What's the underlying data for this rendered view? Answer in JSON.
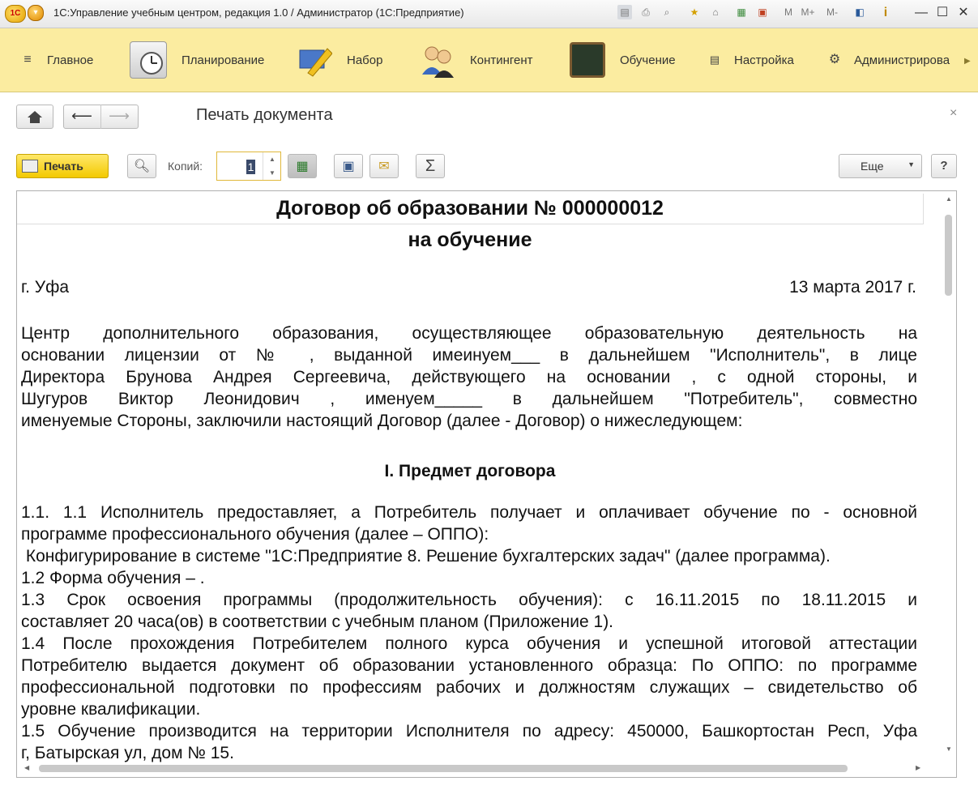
{
  "window": {
    "title": "1С:Управление учебным центром, редакция 1.0 / Администратор  (1С:Предприятие)",
    "logo_text": "1С",
    "controls": {
      "help": "i",
      "minimize": "—",
      "maximize": "☐",
      "close": "✕"
    },
    "toolbar_letters": [
      "M",
      "M+",
      "M-"
    ]
  },
  "sections": [
    {
      "label": "Главное",
      "icon": "hamburger-icon"
    },
    {
      "label": "Планирование",
      "icon": "calendar-clock-icon"
    },
    {
      "label": "Набор",
      "icon": "pencil-icon"
    },
    {
      "label": "Контингент",
      "icon": "people-icon"
    },
    {
      "label": "Обучение",
      "icon": "blackboard-icon"
    },
    {
      "label": "Настройка",
      "icon": "settings-list-icon"
    },
    {
      "label": "Администрирова",
      "icon": "gear-icon"
    }
  ],
  "form": {
    "title": "Печать документа",
    "close_label": "×"
  },
  "toolbar": {
    "print_label": "Печать",
    "copies_label": "Копий:",
    "copies_value": "1",
    "more_label": "Еще",
    "help_label": "?"
  },
  "document": {
    "title_line1": "Договор об образовании № 000000012",
    "title_line2": "на обучение",
    "city": "г. Уфа",
    "date": "13 марта 2017 г.",
    "intro": [
      "Центр дополнительного образования, осуществляющее образовательную деятельность на",
      "основании лицензии от  № , выданной  имеинуем___ в дальнейшем \"Исполнитель\",  в лице",
      "Директора Брунова Андрея Сергеевича, действующего на основании  , с одной стороны, и",
      "Шугуров Виктор Леонидович  , именуем_____ в дальнейшем \"Потребитель\", совместно",
      "именуемые Стороны, заключили настоящий Договор (далее - Договор) о нижеследующем:"
    ],
    "section1_title": "I.  Предмет договора",
    "body": [
      "1.1. 1.1     Исполнитель предоставляет, а Потребитель получает и оплачивает обучение по - основной",
      "программе профессионального обучения (далее – ОППО):",
      " Конфигурирование в системе \"1С:Предприятие 8. Решение бухгалтерских задач\" (далее программа).",
      "1.2 Форма обучения – .",
      "1.3 Срок освоения программы (продолжительность обучения): с 16.11.2015 по 18.11.2015 и",
      "составляет 20 часа(ов) в соответствии с учебным планом (Приложение 1).",
      "1.4 После прохождения Потребителем полного курса обучения и успешной итоговой аттестации",
      "Потребителю выдается документ об образовании установленного образца: По ОППО:  по программе",
      "профессиональной подготовки по профессиям рабочих и должностям служащих – свидетельство об",
      "уровне квалификации.",
      "1.5 Обучение производится на территории Исполнителя по адресу: 450000, Башкортостан Респ, Уфа",
      "г, Батырская ул, дом № 15."
    ]
  }
}
